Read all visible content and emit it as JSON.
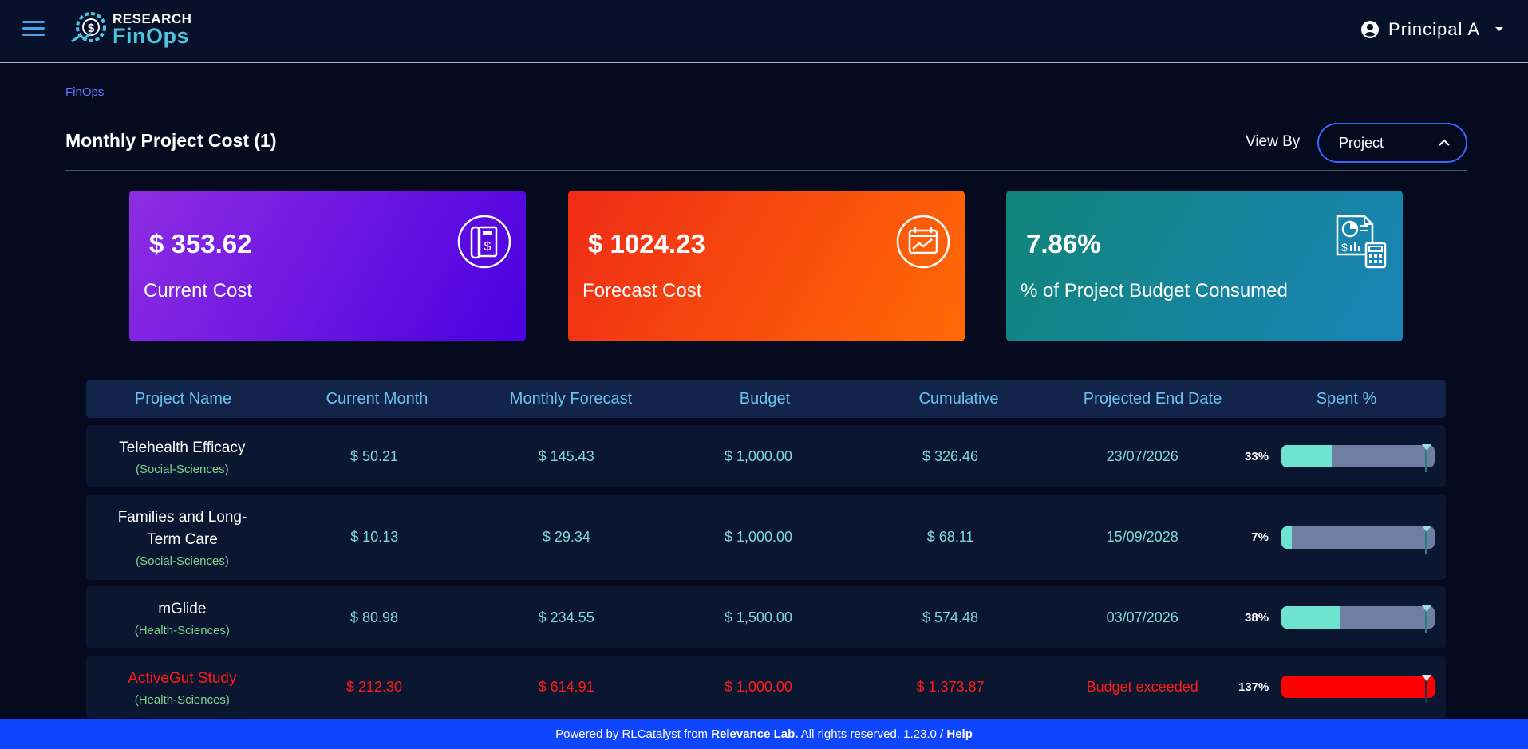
{
  "header": {
    "logo_top": "RESEARCH",
    "logo_bottom": "FinOps",
    "user_name": "Principal A"
  },
  "breadcrumb": "FinOps",
  "page_title": "Monthly Project Cost (1)",
  "view_by": {
    "label": "View By",
    "value": "Project"
  },
  "cards": [
    {
      "value": "$ 353.62",
      "label": "Current Cost",
      "icon": "receipt-icon"
    },
    {
      "value": "$ 1024.23",
      "label": "Forecast Cost",
      "icon": "calendar-chart-icon"
    },
    {
      "value": "7.86%",
      "label": "% of Project Budget Consumed",
      "icon": "report-calculator-icon"
    }
  ],
  "table": {
    "columns": [
      "Project Name",
      "Current Month",
      "Monthly Forecast",
      "Budget",
      "Cumulative",
      "Projected End Date",
      "Spent %"
    ],
    "rows": [
      {
        "name": "Telehealth Efficacy",
        "category": "(Social-Sciences)",
        "current": "$ 50.21",
        "forecast": "$ 145.43",
        "budget": "$ 1,000.00",
        "cumulative": "$ 326.46",
        "end_date": "23/07/2026",
        "spent": "33%",
        "spent_fraction": 0.33,
        "exceeded": false
      },
      {
        "name": "Families and Long-Term Care",
        "category": "(Social-Sciences)",
        "current": "$ 10.13",
        "forecast": "$ 29.34",
        "budget": "$ 1,000.00",
        "cumulative": "$ 68.11",
        "end_date": "15/09/2028",
        "spent": "7%",
        "spent_fraction": 0.07,
        "exceeded": false
      },
      {
        "name": "mGlide",
        "category": "(Health-Sciences)",
        "current": "$ 80.98",
        "forecast": "$ 234.55",
        "budget": "$ 1,500.00",
        "cumulative": "$ 574.48",
        "end_date": "03/07/2026",
        "spent": "38%",
        "spent_fraction": 0.38,
        "exceeded": false
      },
      {
        "name": "ActiveGut Study",
        "category": "(Health-Sciences)",
        "current": "$ 212.30",
        "forecast": "$ 614.91",
        "budget": "$ 1,000.00",
        "cumulative": "$ 1,373.87",
        "end_date": "Budget exceeded",
        "spent": "137%",
        "spent_fraction": 1.37,
        "exceeded": true
      }
    ]
  },
  "footer": {
    "prefix": "Powered by RLCatalyst from ",
    "company": "Relevance Lab.",
    "middle": " All rights reserved. 1.23.0 / ",
    "help": "Help"
  },
  "colors": {
    "accent": "#3d63ff",
    "footer": "#0e46ff",
    "value_text": "#7fd9d0",
    "exceeded": "#ff1a1a",
    "bar_fill": "#6ee3cd"
  }
}
